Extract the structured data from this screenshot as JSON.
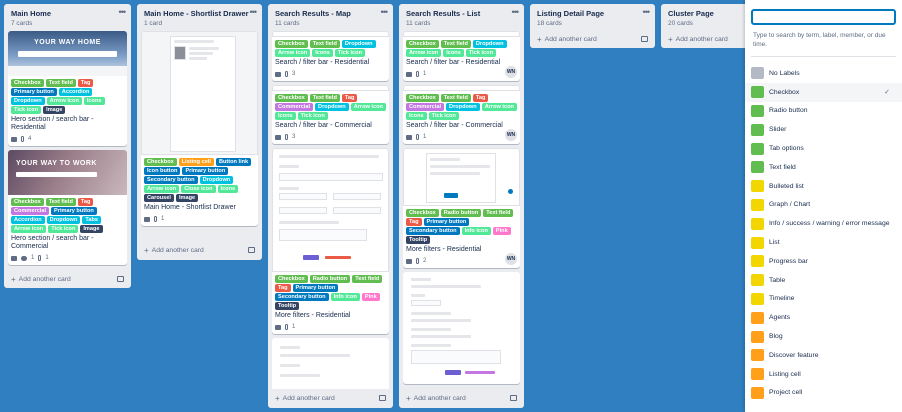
{
  "colors": {
    "green": "#61bd4f",
    "orange": "#ff9f1a",
    "red": "#eb5a46",
    "purple": "#c377e0",
    "blue": "#0079bf",
    "sky": "#00c2e0",
    "lime": "#51e898",
    "pink": "#ff78cb",
    "black": "#344563",
    "yellow": "#f2d600",
    "grey": "#b3bac5"
  },
  "lists": [
    {
      "title": "Main Home",
      "count": "7 cards",
      "cards": [
        {
          "cover": "YOUR WAY HOME",
          "labels": [
            {
              "text": "Checkbox",
              "color": "green"
            },
            {
              "text": "Text field",
              "color": "green"
            },
            {
              "text": "Tag",
              "color": "red"
            },
            {
              "text": "Primary button",
              "color": "blue"
            },
            {
              "text": "Accordion",
              "color": "sky"
            },
            {
              "text": "Dropdown",
              "color": "sky"
            },
            {
              "text": "Arrow icon",
              "color": "lime"
            },
            {
              "text": "Icons",
              "color": "lime"
            },
            {
              "text": "Tick icon",
              "color": "lime"
            },
            {
              "text": "Image",
              "color": "black"
            }
          ],
          "title": "Hero section / search bar - Residential",
          "comments": "",
          "attachments": "4"
        },
        {
          "cover": "YOUR WAY TO WORK",
          "labels": [
            {
              "text": "Checkbox",
              "color": "green"
            },
            {
              "text": "Text field",
              "color": "green"
            },
            {
              "text": "Tag",
              "color": "red"
            },
            {
              "text": "Commercial",
              "color": "purple"
            },
            {
              "text": "Primary button",
              "color": "blue"
            },
            {
              "text": "Accordion",
              "color": "sky"
            },
            {
              "text": "Dropdown",
              "color": "sky"
            },
            {
              "text": "Tabs",
              "color": "sky"
            },
            {
              "text": "Arrow icon",
              "color": "lime"
            },
            {
              "text": "Tick icon",
              "color": "lime"
            },
            {
              "text": "Image",
              "color": "black"
            }
          ],
          "title": "Hero section / search bar - Commercial",
          "comments": "1",
          "attachments": "1"
        }
      ]
    },
    {
      "title": "Main Home - Shortlist Drawer",
      "count": "1 card",
      "cards": [
        {
          "labels": [
            {
              "text": "Checkbox",
              "color": "green"
            },
            {
              "text": "Listing cell",
              "color": "orange"
            },
            {
              "text": "Button link",
              "color": "blue"
            },
            {
              "text": "Icon button",
              "color": "blue"
            },
            {
              "text": "Primary button",
              "color": "blue"
            },
            {
              "text": "Secondary button",
              "color": "blue"
            },
            {
              "text": "Dropdown",
              "color": "sky"
            },
            {
              "text": "Arrow icon",
              "color": "lime"
            },
            {
              "text": "Close icon",
              "color": "lime"
            },
            {
              "text": "Icons",
              "color": "lime"
            },
            {
              "text": "Carousel",
              "color": "black"
            },
            {
              "text": "Image",
              "color": "black"
            }
          ],
          "title": "Main Home - Shortlist Drawer",
          "comments": "",
          "attachments": "1"
        }
      ]
    },
    {
      "title": "Search Results - Map",
      "count": "11 cards",
      "cards": [
        {
          "labels": [
            {
              "text": "Checkbox",
              "color": "green"
            },
            {
              "text": "Text field",
              "color": "green"
            },
            {
              "text": "Dropdown",
              "color": "sky"
            },
            {
              "text": "Arrow icon",
              "color": "lime"
            },
            {
              "text": "Icons",
              "color": "lime"
            },
            {
              "text": "Tick icon",
              "color": "lime"
            }
          ],
          "title": "Search / filter bar - Residential",
          "comments": "",
          "attachments": "3"
        },
        {
          "labels": [
            {
              "text": "Checkbox",
              "color": "green"
            },
            {
              "text": "Text field",
              "color": "green"
            },
            {
              "text": "Tag",
              "color": "red"
            },
            {
              "text": "Commercial",
              "color": "purple"
            },
            {
              "text": "Dropdown",
              "color": "sky"
            },
            {
              "text": "Arrow icon",
              "color": "lime"
            },
            {
              "text": "Icons",
              "color": "lime"
            },
            {
              "text": "Tick icon",
              "color": "lime"
            }
          ],
          "title": "Search / filter bar - Commercial",
          "comments": "",
          "attachments": "3"
        },
        {
          "labels": [
            {
              "text": "Checkbox",
              "color": "green"
            },
            {
              "text": "Radio button",
              "color": "green"
            },
            {
              "text": "Text field",
              "color": "green"
            },
            {
              "text": "Tag",
              "color": "red"
            },
            {
              "text": "Primary button",
              "color": "blue"
            },
            {
              "text": "Secondary button",
              "color": "blue"
            },
            {
              "text": "Info icon",
              "color": "lime"
            },
            {
              "text": "Pink",
              "color": "pink"
            },
            {
              "text": "Tooltip",
              "color": "black"
            }
          ],
          "title": "More filters - Residential",
          "comments": "",
          "attachments": "1"
        }
      ]
    },
    {
      "title": "Search Results - List",
      "count": "11 cards",
      "cards": [
        {
          "labels": [
            {
              "text": "Checkbox",
              "color": "green"
            },
            {
              "text": "Text field",
              "color": "green"
            },
            {
              "text": "Dropdown",
              "color": "sky"
            },
            {
              "text": "Arrow icon",
              "color": "lime"
            },
            {
              "text": "Icons",
              "color": "lime"
            },
            {
              "text": "Tick icon",
              "color": "lime"
            }
          ],
          "title": "Search / filter bar - Residential",
          "comments": "",
          "attachments": "1",
          "avatar": "WN"
        },
        {
          "labels": [
            {
              "text": "Checkbox",
              "color": "green"
            },
            {
              "text": "Text field",
              "color": "green"
            },
            {
              "text": "Tag",
              "color": "red"
            },
            {
              "text": "Commercial",
              "color": "purple"
            },
            {
              "text": "Dropdown",
              "color": "sky"
            },
            {
              "text": "Arrow icon",
              "color": "lime"
            },
            {
              "text": "Icons",
              "color": "lime"
            },
            {
              "text": "Tick icon",
              "color": "lime"
            }
          ],
          "title": "Search / filter bar - Commercial",
          "comments": "",
          "attachments": "1",
          "avatar": "WN"
        },
        {
          "labels": [
            {
              "text": "Checkbox",
              "color": "green"
            },
            {
              "text": "Radio button",
              "color": "green"
            },
            {
              "text": "Text field",
              "color": "green"
            },
            {
              "text": "Tag",
              "color": "red"
            },
            {
              "text": "Primary button",
              "color": "blue"
            },
            {
              "text": "Secondary button",
              "color": "blue"
            },
            {
              "text": "Info icon",
              "color": "lime"
            },
            {
              "text": "Pink",
              "color": "pink"
            },
            {
              "text": "Tooltip",
              "color": "black"
            }
          ],
          "title": "More filters - Residential",
          "comments": "",
          "attachments": "2",
          "avatar": "WN"
        }
      ]
    },
    {
      "title": "Listing Detail Page",
      "count": "18 cards",
      "cards": []
    },
    {
      "title": "Cluster Page",
      "count": "20 cards",
      "cards": []
    }
  ],
  "add_card_label": "Add another card",
  "search": {
    "value": "",
    "placeholder": "",
    "help": "Type to search by term, label, member, or due time."
  },
  "label_options": [
    {
      "name": "No Labels",
      "color": "grey"
    },
    {
      "name": "Checkbox",
      "color": "green",
      "selected": true
    },
    {
      "name": "Radio button",
      "color": "green"
    },
    {
      "name": "Slider",
      "color": "green"
    },
    {
      "name": "Tab options",
      "color": "green"
    },
    {
      "name": "Text field",
      "color": "green"
    },
    {
      "name": "Bulleted list",
      "color": "yellow"
    },
    {
      "name": "Graph / Chart",
      "color": "yellow"
    },
    {
      "name": "Info / success / warning / error message",
      "color": "yellow"
    },
    {
      "name": "List",
      "color": "yellow"
    },
    {
      "name": "Progress bar",
      "color": "yellow"
    },
    {
      "name": "Table",
      "color": "yellow"
    },
    {
      "name": "Timeline",
      "color": "yellow"
    },
    {
      "name": "Agents",
      "color": "orange"
    },
    {
      "name": "Blog",
      "color": "orange"
    },
    {
      "name": "Discover feature",
      "color": "orange"
    },
    {
      "name": "Listing cell",
      "color": "orange"
    },
    {
      "name": "Project cell",
      "color": "orange"
    }
  ]
}
